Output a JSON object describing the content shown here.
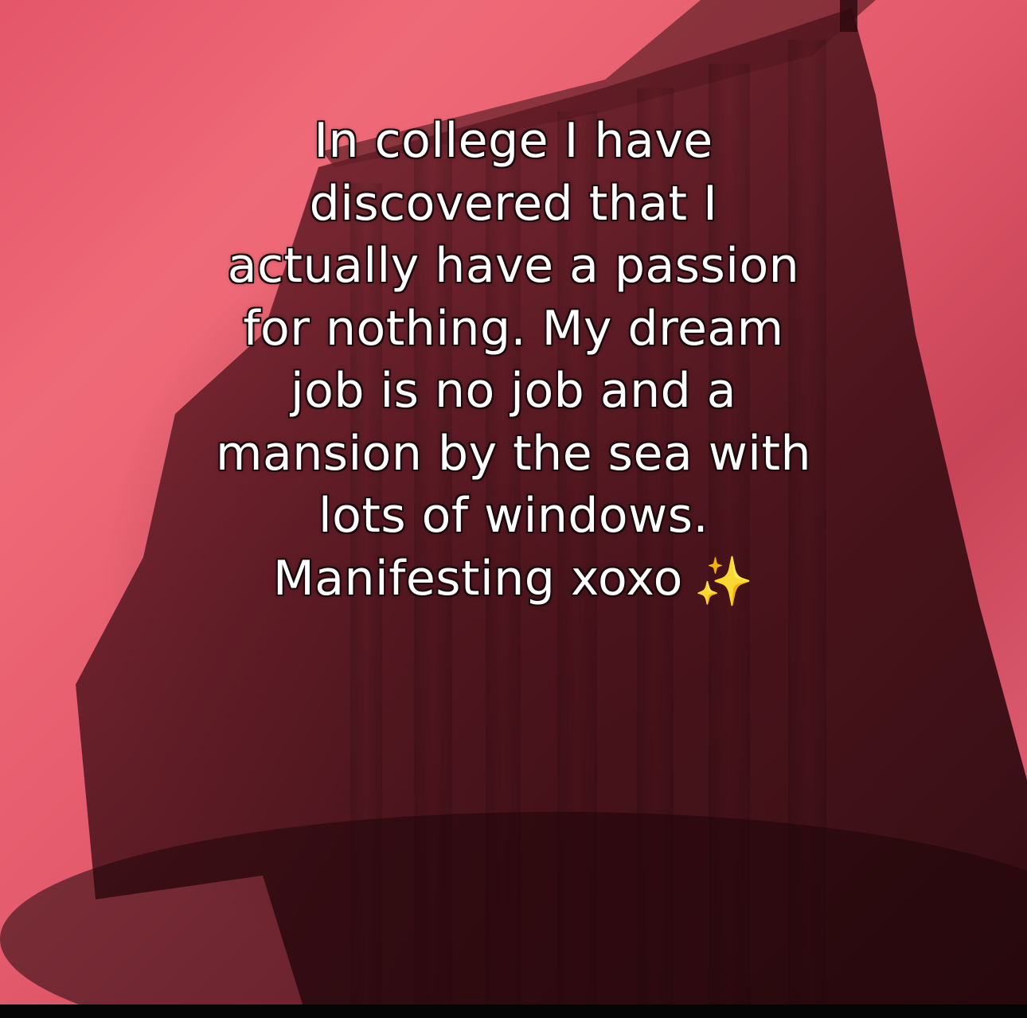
{
  "caption": {
    "lines": [
      "In college I have",
      "discovered that I",
      "actually have a passion",
      "for nothing. My dream",
      "job is no job and a",
      "mansion by the sea with",
      "lots of windows.",
      "Manifesting xoxo"
    ],
    "emoji": "✨",
    "emoji_name": "sparkles-icon"
  },
  "colors": {
    "background_pink": "#e4556a",
    "curtain_dark": "#5a1a24",
    "text": "#ffffff",
    "sparkles": "#f3c53b"
  }
}
